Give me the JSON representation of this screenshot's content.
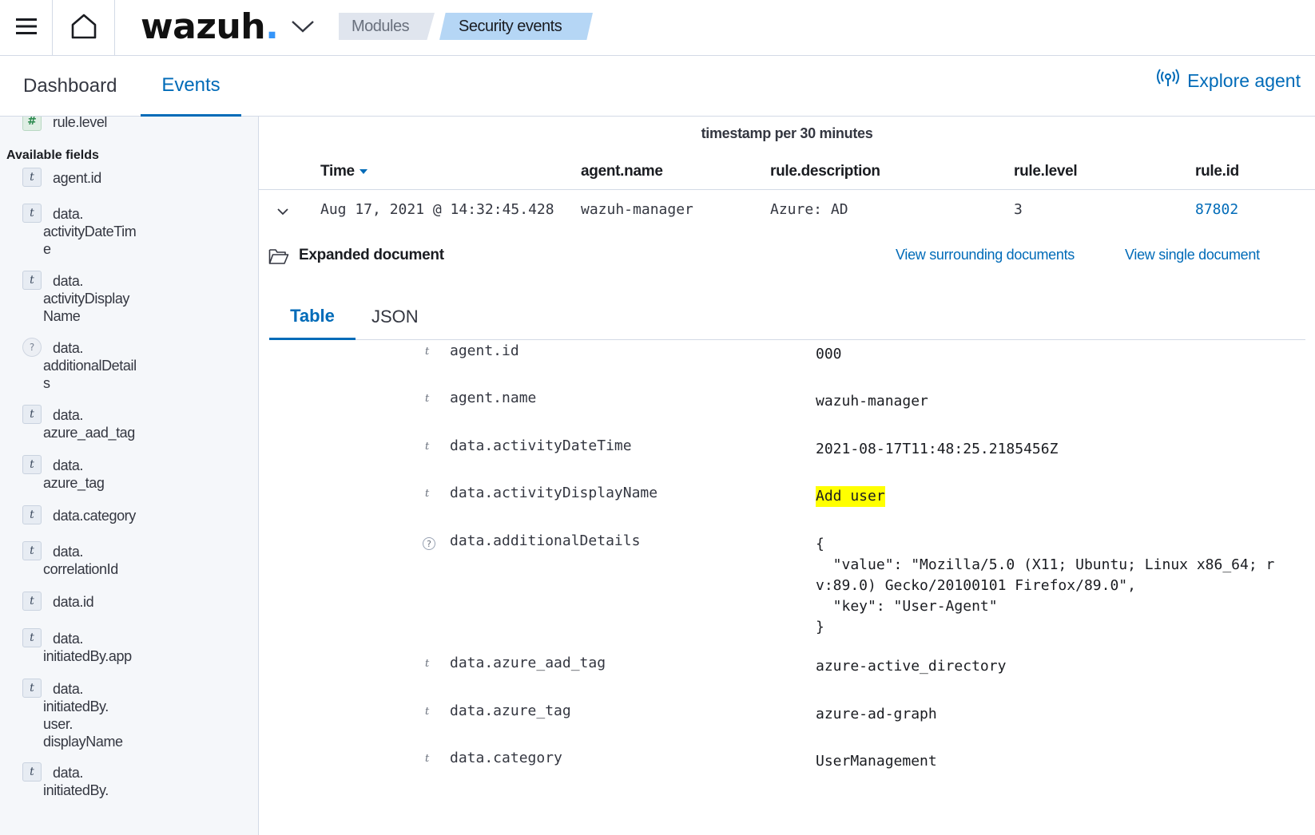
{
  "header": {
    "logo_text": "wazuh",
    "logo_dot": ".",
    "breadcrumbs": [
      "Modules",
      "Security events"
    ]
  },
  "tabs": {
    "dashboard": "Dashboard",
    "events": "Events",
    "explore_agent": "Explore agent"
  },
  "sidebar": {
    "selected_field": {
      "type": "#",
      "name": "rule.level"
    },
    "available_title": "Available fields",
    "fields": [
      {
        "type": "t",
        "lines": [
          "agent.id"
        ]
      },
      {
        "type": "t",
        "lines": [
          "data.",
          "activityDateTim",
          "e"
        ]
      },
      {
        "type": "t",
        "lines": [
          "data.",
          "activityDisplay",
          "Name"
        ]
      },
      {
        "type": "?",
        "lines": [
          "data.",
          "additionalDetail",
          "s"
        ]
      },
      {
        "type": "t",
        "lines": [
          "data.",
          "azure_aad_tag"
        ]
      },
      {
        "type": "t",
        "lines": [
          "data.",
          "azure_tag"
        ]
      },
      {
        "type": "t",
        "lines": [
          "data.category"
        ]
      },
      {
        "type": "t",
        "lines": [
          "data.",
          "correlationId"
        ]
      },
      {
        "type": "t",
        "lines": [
          "data.id"
        ]
      },
      {
        "type": "t",
        "lines": [
          "data.",
          "initiatedBy.app"
        ]
      },
      {
        "type": "t",
        "lines": [
          "data.",
          "initiatedBy.",
          "user.",
          "displayName"
        ]
      },
      {
        "type": "t",
        "lines": [
          "data.",
          "initiatedBy."
        ]
      }
    ]
  },
  "main": {
    "chart_caption": "timestamp per 30 minutes",
    "columns": {
      "time": "Time",
      "agent_name": "agent.name",
      "rule_description": "rule.description",
      "rule_level": "rule.level",
      "rule_id": "rule.id"
    },
    "row": {
      "time": "Aug 17, 2021 @ 14:32:45.428",
      "agent_name": "wazuh-manager",
      "rule_description": "Azure: AD",
      "rule_level": "3",
      "rule_id": "87802"
    },
    "expanded": {
      "title": "Expanded document",
      "link_surrounding": "View surrounding documents",
      "link_single": "View single document",
      "tab_table": "Table",
      "tab_json": "JSON",
      "fields": [
        {
          "type": "t",
          "key": "agent.id",
          "value": "000"
        },
        {
          "type": "t",
          "key": "agent.name",
          "value": "wazuh-manager"
        },
        {
          "type": "t",
          "key": "data.activityDateTime",
          "value": "2021-08-17T11:48:25.2185456Z"
        },
        {
          "type": "t",
          "key": "data.activityDisplayName",
          "value": "Add user",
          "highlight": true
        },
        {
          "type": "?",
          "key": "data.additionalDetails",
          "value": "{\n  \"value\": \"Mozilla/5.0 (X11; Ubuntu; Linux x86_64; r\nv:89.0) Gecko/20100101 Firefox/89.0\",\n  \"key\": \"User-Agent\"\n}"
        },
        {
          "type": "t",
          "key": "data.azure_aad_tag",
          "value": "azure-active_directory"
        },
        {
          "type": "t",
          "key": "data.azure_tag",
          "value": "azure-ad-graph"
        },
        {
          "type": "t",
          "key": "data.category",
          "value": "UserManagement"
        }
      ]
    }
  }
}
